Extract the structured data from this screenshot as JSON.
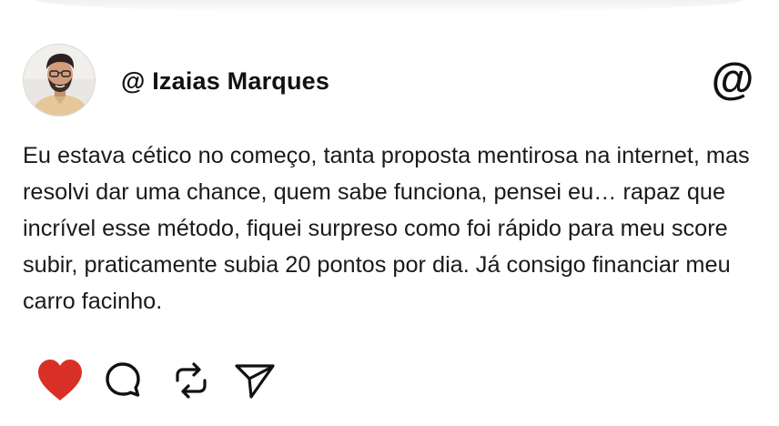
{
  "post": {
    "author": {
      "username": "@ Izaias Marques",
      "avatar_icon": "avatar"
    },
    "brand_icon": "at-sign-icon",
    "brand_glyph": "@",
    "text": "Eu estava cético no começo, tanta proposta mentirosa na internet, mas resolvi dar uma chance, quem sabe funciona, pensei eu… rapaz que incrível esse método, fiquei surpreso como foi rápido para meu score subir, praticamente subia 20 pontos por dia. Já consigo financiar meu carro facinho.",
    "actions": [
      {
        "icon": "heart-icon",
        "liked": true
      },
      {
        "icon": "comment-icon"
      },
      {
        "icon": "repost-icon"
      },
      {
        "icon": "share-icon"
      }
    ]
  },
  "colors": {
    "like": "#d93025",
    "text": "#1a1a1a",
    "icon_stroke": "#111111"
  }
}
